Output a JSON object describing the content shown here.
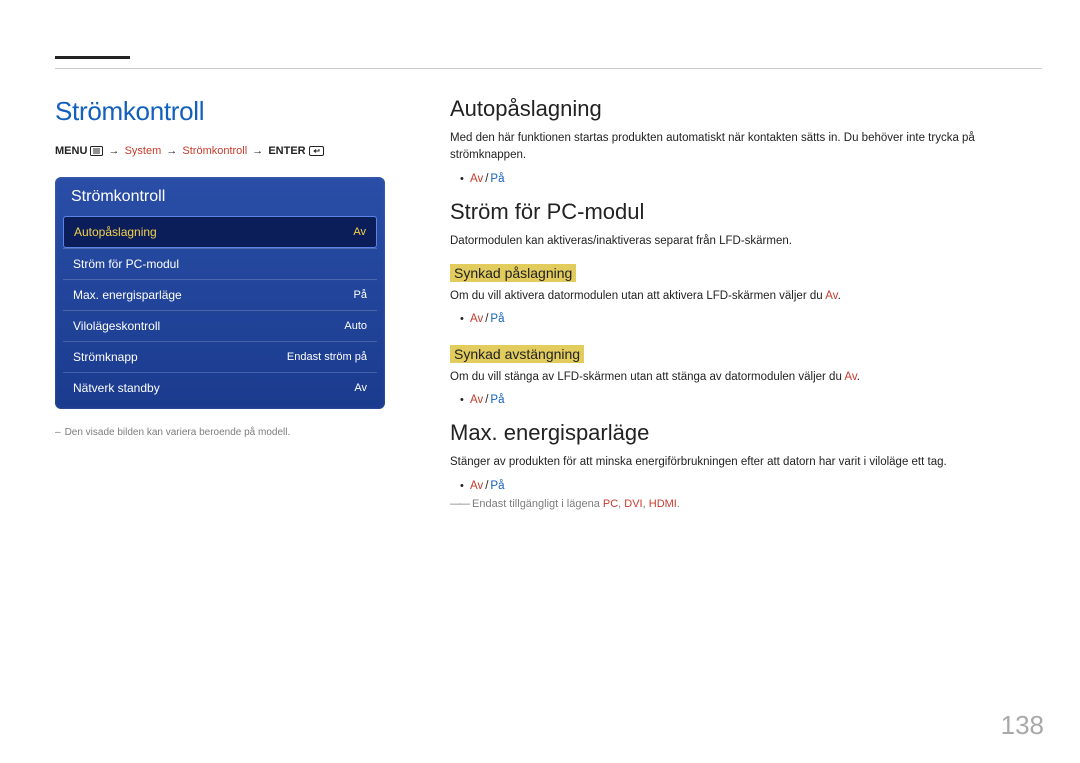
{
  "page_number": "138",
  "left": {
    "section_title": "Strömkontroll",
    "breadcrumb": {
      "menu": "MENU",
      "system": "System",
      "power": "Strömkontroll",
      "enter": "ENTER"
    },
    "osd": {
      "title": "Strömkontroll",
      "rows": [
        {
          "label": "Autopåslagning",
          "value": "Av",
          "selected": true
        },
        {
          "label": "Ström för PC-modul",
          "value": "",
          "selected": false
        },
        {
          "label": "Max. energisparläge",
          "value": "På",
          "selected": false
        },
        {
          "label": "Vilolägeskontroll",
          "value": "Auto",
          "selected": false
        },
        {
          "label": "Strömknapp",
          "value": "Endast ström på",
          "selected": false
        },
        {
          "label": "Nätverk standby",
          "value": "Av",
          "selected": false
        }
      ]
    },
    "footnote": "Den visade bilden kan variera beroende på modell."
  },
  "right": {
    "sec1": {
      "title": "Autopåslagning",
      "desc": "Med den här funktionen startas produkten automatiskt när kontakten sätts in. Du behöver inte trycka på strömknappen.",
      "opt_off": "Av",
      "opt_on": "På"
    },
    "sec2": {
      "title": "Ström för PC-modul",
      "desc": "Datormodulen kan aktiveras/inaktiveras separat från LFD-skärmen.",
      "sub1": {
        "title": "Synkad påslagning",
        "desc_pre": "Om du vill aktivera datormodulen utan att aktivera LFD-skärmen väljer du ",
        "desc_hl": "Av",
        "desc_post": ".",
        "opt_off": "Av",
        "opt_on": "På"
      },
      "sub2": {
        "title": "Synkad avstängning",
        "desc_pre": "Om du vill stänga av LFD-skärmen utan att stänga av datormodulen väljer du ",
        "desc_hl": "Av",
        "desc_post": ".",
        "opt_off": "Av",
        "opt_on": "På"
      }
    },
    "sec3": {
      "title": "Max. energisparläge",
      "desc": "Stänger av produkten för att minska energiförbrukningen efter att datorn har varit i viloläge ett tag.",
      "opt_off": "Av",
      "opt_on": "På",
      "foot_pre": "Endast tillgängligt i lägena ",
      "foot_m1": "PC",
      "foot_m2": "DVI",
      "foot_m3": "HDMI",
      "foot_post": "."
    }
  }
}
